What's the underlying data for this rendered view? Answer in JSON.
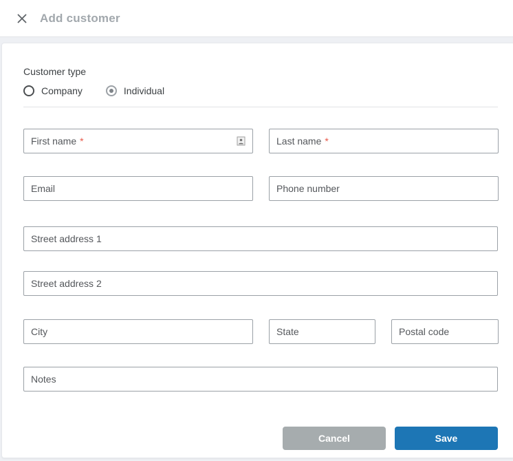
{
  "header": {
    "title": "Add customer",
    "close_icon": "x-icon"
  },
  "customer_type": {
    "label": "Customer type",
    "options": [
      {
        "label": "Company",
        "selected": false
      },
      {
        "label": "Individual",
        "selected": true
      }
    ]
  },
  "form": {
    "required_marker": "*",
    "fields": {
      "first_name": {
        "label": "First name",
        "required": true,
        "icon": "contact-card-autofill-icon"
      },
      "last_name": {
        "label": "Last name",
        "required": true
      },
      "email": {
        "label": "Email",
        "required": false
      },
      "phone": {
        "label": "Phone number",
        "required": false
      },
      "street1": {
        "label": "Street address 1",
        "required": false
      },
      "street2": {
        "label": "Street address 2",
        "required": false
      },
      "city": {
        "label": "City",
        "required": false
      },
      "state": {
        "label": "State",
        "required": false
      },
      "postal_code": {
        "label": "Postal code",
        "required": false
      },
      "notes": {
        "label": "Notes",
        "required": false
      }
    }
  },
  "actions": {
    "cancel_label": "Cancel",
    "save_label": "Save"
  },
  "colors": {
    "save_blue": "#1d76b5",
    "cancel_gray": "#a6acae",
    "required_red": "#e8594a",
    "title_gray": "#a2a8ad",
    "field_border": "#9aa0a6"
  }
}
